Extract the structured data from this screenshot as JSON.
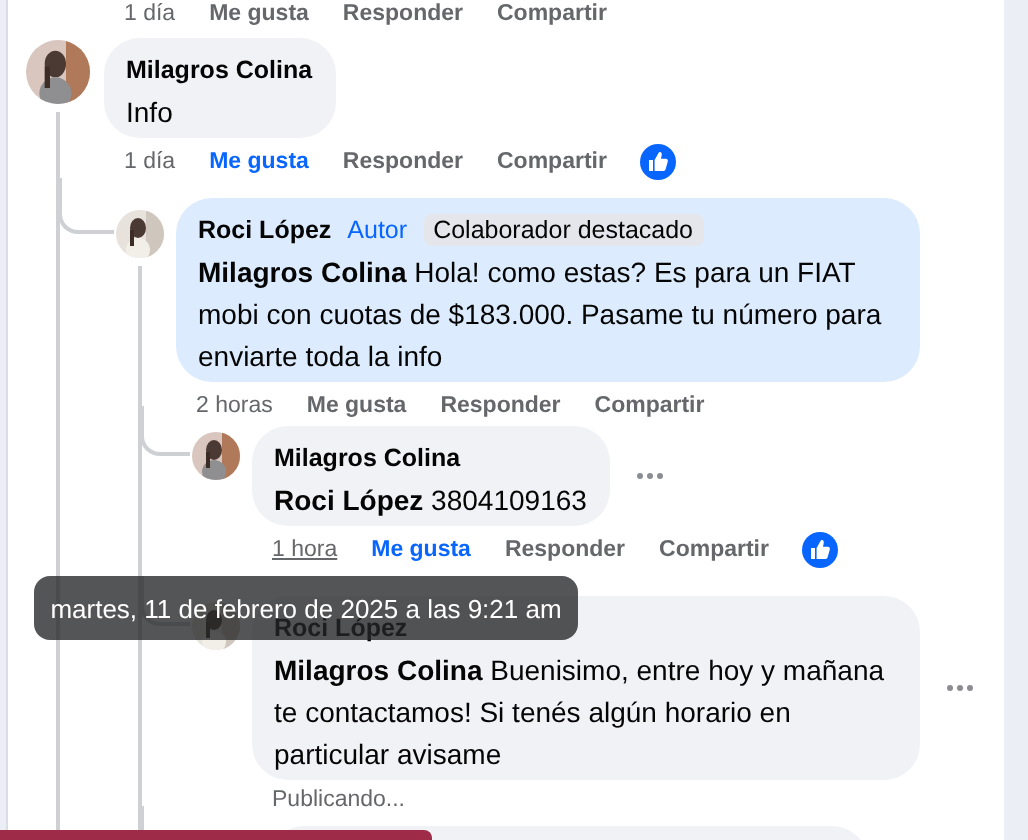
{
  "previous_actions": {
    "time": "1 día",
    "time_hovered": false,
    "like": "Me gusta",
    "liked": false,
    "reply": "Responder",
    "share": "Compartir",
    "reaction": false
  },
  "comments": [
    {
      "kind": "comment",
      "author": "Milagros Colina",
      "text": "Info",
      "highlighted": false,
      "more_menu": false,
      "actions": {
        "time": "1 día",
        "time_hovered": false,
        "like": "Me gusta",
        "liked": true,
        "reply": "Responder",
        "share": "Compartir",
        "reaction": true
      },
      "children": [
        {
          "kind": "comment",
          "author": "Roci López",
          "badges": [
            {
              "kind": "role",
              "label": "Autor"
            },
            {
              "kind": "tag",
              "label": "Colaborador destacado"
            }
          ],
          "text": "**Milagros Colina** Hola! como estas? Es para un FIAT mobi con cuotas de $183.000. Pasame tu número para enviarte toda la info",
          "highlighted": true,
          "more_menu": false,
          "actions": {
            "time": "2 horas",
            "time_hovered": false,
            "like": "Me gusta",
            "liked": false,
            "reply": "Responder",
            "share": "Compartir",
            "reaction": false
          },
          "children": [
            {
              "kind": "comment",
              "author": "Milagros Colina",
              "text": "**Roci López** 3804109163",
              "highlighted": false,
              "more_menu": true,
              "actions": {
                "time": "1 hora",
                "time_hovered": true,
                "like": "Me gusta",
                "liked": true,
                "reply": "Responder",
                "share": "Compartir",
                "reaction": true
              }
            },
            {
              "kind": "comment",
              "author": "Roci López",
              "text": "**Milagros Colina** Buenisimo, entre hoy y mañana te contactamos! Si tenés algún horario en particular avisame",
              "highlighted": false,
              "more_menu": true,
              "status": "Publicando..."
            },
            {
              "kind": "partial"
            }
          ]
        }
      ]
    }
  ],
  "tooltip": "martes, 11 de febrero de 2025 a las 9:21 am"
}
